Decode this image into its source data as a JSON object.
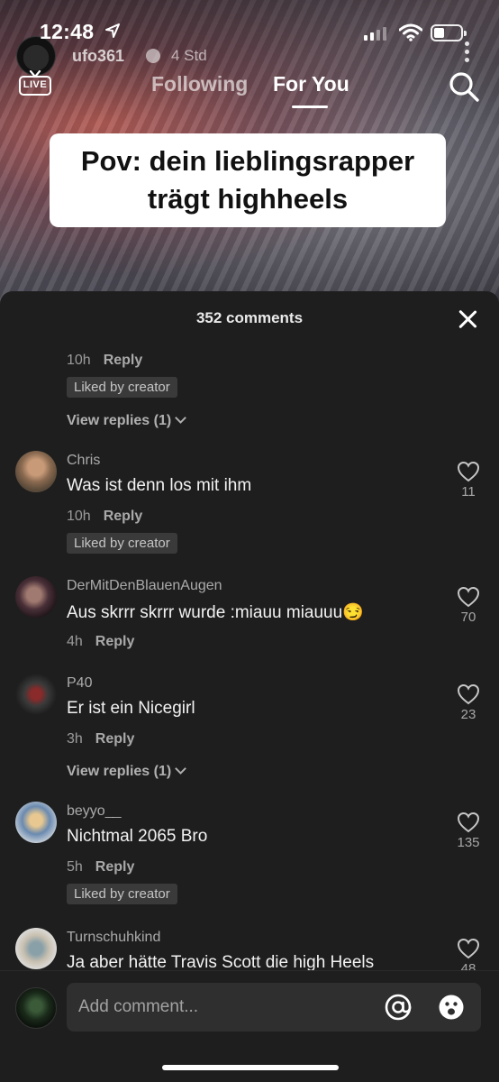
{
  "status_bar": {
    "time": "12:48"
  },
  "video": {
    "creator": {
      "username": "ufo361",
      "time_ago": "4 Std"
    },
    "live_label": "LIVE",
    "caption_lines": [
      "Pov: dein lieblingsrapper",
      "trägt highheels"
    ]
  },
  "nav": {
    "following": "Following",
    "for_you": "For You",
    "active": "For You"
  },
  "sheet": {
    "title": "352 comments",
    "comments": [
      {
        "user": "",
        "text": "",
        "time": "10h",
        "reply": "Reply",
        "badge": "Liked by creator",
        "view_replies": "View replies (1)",
        "likes": ""
      },
      {
        "user": "Chris",
        "text": "Was ist denn los mit ihm",
        "time": "10h",
        "reply": "Reply",
        "badge": "Liked by creator",
        "likes": "11"
      },
      {
        "user": "DerMitDenBlauenAugen",
        "text": "Aus skrrr skrrr wurde :miauu miauuu",
        "emoji": "😏",
        "time": "4h",
        "reply": "Reply",
        "likes": "70"
      },
      {
        "user": "P40",
        "text": "Er ist ein Nicegirl",
        "time": "3h",
        "reply": "Reply",
        "view_replies": "View replies (1)",
        "likes": "23"
      },
      {
        "user": "beyyo__",
        "text": "Nichtmal 2065 Bro",
        "time": "5h",
        "reply": "Reply",
        "badge": "Liked by creator",
        "likes": "135"
      },
      {
        "user": "Turnschuhkind",
        "text": "Ja aber hätte Travis Scott die high Heels",
        "likes": "48"
      }
    ]
  },
  "input": {
    "placeholder": "Add comment..."
  },
  "colors": {
    "sheet_bg": "#1e1e1e",
    "badge_bg": "#3a3a3a",
    "input_bg": "#2f2f2f"
  }
}
